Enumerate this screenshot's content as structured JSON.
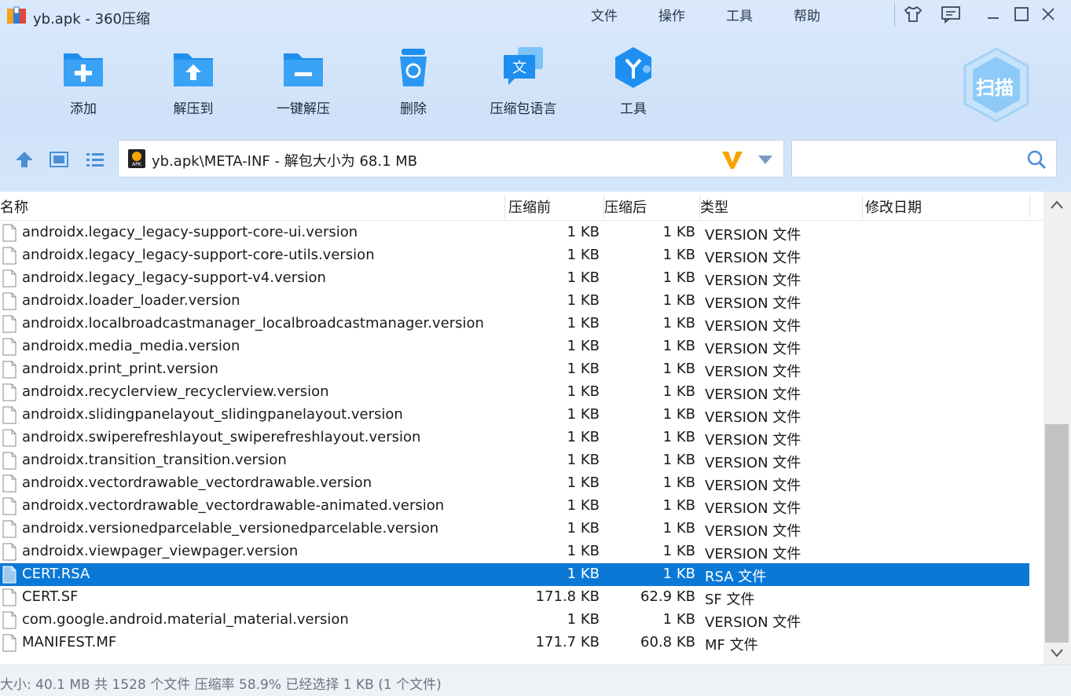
{
  "window": {
    "title": "yb.apk - 360压缩"
  },
  "menu": [
    "文件",
    "操作",
    "工具",
    "帮助"
  ],
  "toolbar": [
    {
      "label": "添加",
      "icon": "add-folder-icon"
    },
    {
      "label": "解压到",
      "icon": "extract-to-folder-icon"
    },
    {
      "label": "一键解压",
      "icon": "one-click-extract-icon"
    },
    {
      "label": "删除",
      "icon": "recycle-bin-icon"
    },
    {
      "label": "压缩包语言",
      "icon": "language-icon"
    },
    {
      "label": "工具",
      "icon": "tools-icon"
    }
  ],
  "scan": {
    "label": "扫描"
  },
  "path": {
    "text": "yb.apk\\META-INF - 解包大小为 68.1 MB"
  },
  "columns": {
    "name": "名称",
    "before": "压缩前",
    "after": "压缩后",
    "type": "类型",
    "modified": "修改日期"
  },
  "rows": [
    {
      "name": "androidx.legacy_legacy-support-core-ui.version",
      "before": "1 KB",
      "after": "1 KB",
      "type": "VERSION 文件"
    },
    {
      "name": "androidx.legacy_legacy-support-core-utils.version",
      "before": "1 KB",
      "after": "1 KB",
      "type": "VERSION 文件"
    },
    {
      "name": "androidx.legacy_legacy-support-v4.version",
      "before": "1 KB",
      "after": "1 KB",
      "type": "VERSION 文件"
    },
    {
      "name": "androidx.loader_loader.version",
      "before": "1 KB",
      "after": "1 KB",
      "type": "VERSION 文件"
    },
    {
      "name": "androidx.localbroadcastmanager_localbroadcastmanager.version",
      "before": "1 KB",
      "after": "1 KB",
      "type": "VERSION 文件"
    },
    {
      "name": "androidx.media_media.version",
      "before": "1 KB",
      "after": "1 KB",
      "type": "VERSION 文件"
    },
    {
      "name": "androidx.print_print.version",
      "before": "1 KB",
      "after": "1 KB",
      "type": "VERSION 文件"
    },
    {
      "name": "androidx.recyclerview_recyclerview.version",
      "before": "1 KB",
      "after": "1 KB",
      "type": "VERSION 文件"
    },
    {
      "name": "androidx.slidingpanelayout_slidingpanelayout.version",
      "before": "1 KB",
      "after": "1 KB",
      "type": "VERSION 文件"
    },
    {
      "name": "androidx.swiperefreshlayout_swiperefreshlayout.version",
      "before": "1 KB",
      "after": "1 KB",
      "type": "VERSION 文件"
    },
    {
      "name": "androidx.transition_transition.version",
      "before": "1 KB",
      "after": "1 KB",
      "type": "VERSION 文件"
    },
    {
      "name": "androidx.vectordrawable_vectordrawable.version",
      "before": "1 KB",
      "after": "1 KB",
      "type": "VERSION 文件"
    },
    {
      "name": "androidx.vectordrawable_vectordrawable-animated.version",
      "before": "1 KB",
      "after": "1 KB",
      "type": "VERSION 文件"
    },
    {
      "name": "androidx.versionedparcelable_versionedparcelable.version",
      "before": "1 KB",
      "after": "1 KB",
      "type": "VERSION 文件"
    },
    {
      "name": "androidx.viewpager_viewpager.version",
      "before": "1 KB",
      "after": "1 KB",
      "type": "VERSION 文件"
    },
    {
      "name": "CERT.RSA",
      "before": "1 KB",
      "after": "1 KB",
      "type": "RSA 文件",
      "selected": true
    },
    {
      "name": "CERT.SF",
      "before": "171.8 KB",
      "after": "62.9 KB",
      "type": "SF 文件"
    },
    {
      "name": "com.google.android.material_material.version",
      "before": "1 KB",
      "after": "1 KB",
      "type": "VERSION 文件"
    },
    {
      "name": "MANIFEST.MF",
      "before": "171.7 KB",
      "after": "60.8 KB",
      "type": "MF 文件"
    }
  ],
  "status": {
    "text": "大小: 40.1 MB 共 1528 个文件 压缩率 58.9% 已经选择 1 KB (1 个文件)"
  },
  "colors": {
    "accent": "#0a78d7",
    "icon_blue": "#1e8ff0",
    "bg_top": "#d5e6fb",
    "v_logo": "#f5a400"
  }
}
